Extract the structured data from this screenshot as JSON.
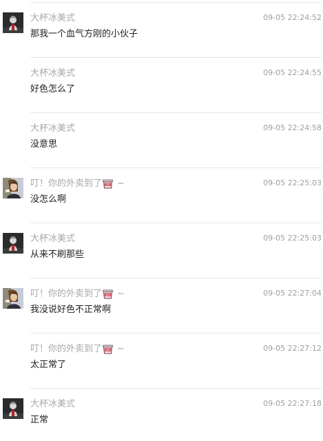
{
  "messages": [
    {
      "author": "大杯冰美式",
      "avatar": "dark-avatar",
      "show_avatar": true,
      "sticker": false,
      "suffix": "",
      "time": "09-05 22:24:52",
      "text": "那我一个血气方刚的小伙子"
    },
    {
      "author": "大杯冰美式",
      "avatar": "dark-avatar",
      "show_avatar": false,
      "sticker": false,
      "suffix": "",
      "time": "09-05 22:24:55",
      "text": "好色怎么了"
    },
    {
      "author": "大杯冰美式",
      "avatar": "dark-avatar",
      "show_avatar": false,
      "sticker": false,
      "suffix": "",
      "time": "09-05 22:24:58",
      "text": "没意思"
    },
    {
      "author": "叮！你的外卖到了",
      "avatar": "photo-avatar",
      "show_avatar": true,
      "sticker": true,
      "suffix": "~",
      "time": "09-05 22:25:03",
      "text": "没怎么啊"
    },
    {
      "author": "大杯冰美式",
      "avatar": "dark-avatar",
      "show_avatar": true,
      "sticker": false,
      "suffix": "",
      "time": "09-05 22:25:03",
      "text": "从来不刷那些"
    },
    {
      "author": "叮！你的外卖到了",
      "avatar": "photo-avatar",
      "show_avatar": true,
      "sticker": true,
      "suffix": "~",
      "time": "09-05 22:27:04",
      "text": "我没说好色不正常啊"
    },
    {
      "author": "叮！你的外卖到了",
      "avatar": "photo-avatar",
      "show_avatar": false,
      "sticker": true,
      "suffix": "~",
      "time": "09-05 22:27:12",
      "text": "太正常了"
    },
    {
      "author": "大杯冰美式",
      "avatar": "dark-avatar",
      "show_avatar": true,
      "sticker": false,
      "suffix": "",
      "time": "09-05 22:27:18",
      "text": "正常"
    }
  ],
  "colors": {
    "name": "#a8a8a8",
    "time": "#9e9e9e",
    "text": "#222222",
    "divider": "#e6e6e6"
  },
  "icons": {
    "sticker": "food-container-icon",
    "dark_avatar": "dark-avatar",
    "photo_avatar": "photo-avatar"
  }
}
